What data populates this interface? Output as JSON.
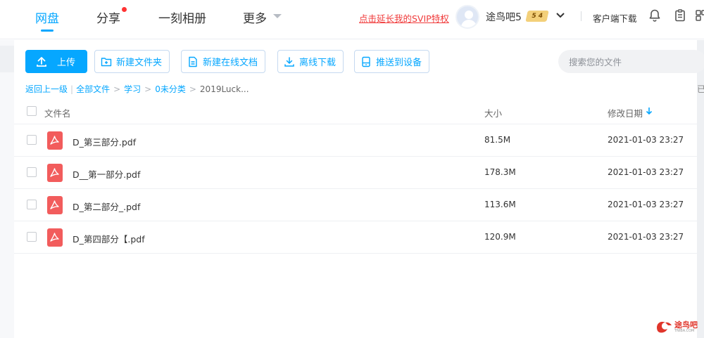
{
  "nav": {
    "tabs": [
      {
        "label": "网盘"
      },
      {
        "label": "分享"
      },
      {
        "label": "一刻相册"
      },
      {
        "label": "更多"
      }
    ]
  },
  "header": {
    "promo_text": "点击延长我的SVIP特权",
    "username": "途鸟吧5",
    "vip_level_left": "5",
    "vip_level_right": "4",
    "client_download": "客户端下载"
  },
  "toolbar": {
    "upload": "上传",
    "new_folder": "新建文件夹",
    "new_online_doc": "新建在线文档",
    "offline_download": "离线下载",
    "push_to_device": "推送到设备"
  },
  "search": {
    "placeholder": "搜索您的文件"
  },
  "breadcrumb": {
    "back": "返回上一级",
    "sep": "|",
    "items": [
      "全部文件",
      "学习",
      "0未分类",
      "2019Luck..."
    ],
    "loaded_count": "已"
  },
  "table": {
    "columns": {
      "name": "文件名",
      "size": "大小",
      "modified": "修改日期"
    },
    "rows": [
      {
        "name": "D_第三部分.pdf",
        "size": "81.5M",
        "modified": "2021-01-03 23:27"
      },
      {
        "name": "D__第一部分.pdf",
        "size": "178.3M",
        "modified": "2021-01-03 23:27"
      },
      {
        "name": "D_第二部分_.pdf",
        "size": "113.6M",
        "modified": "2021-01-03 23:27"
      },
      {
        "name": "D_第四部分【.pdf",
        "size": "120.9M",
        "modified": "2021-01-03 23:27"
      }
    ]
  },
  "watermark": {
    "text": "途鸟吧",
    "sub": "TNIBA.COM"
  },
  "colors": {
    "accent": "#06a7ff",
    "promo": "#f03a3a",
    "pdf": "#f25c5c"
  }
}
